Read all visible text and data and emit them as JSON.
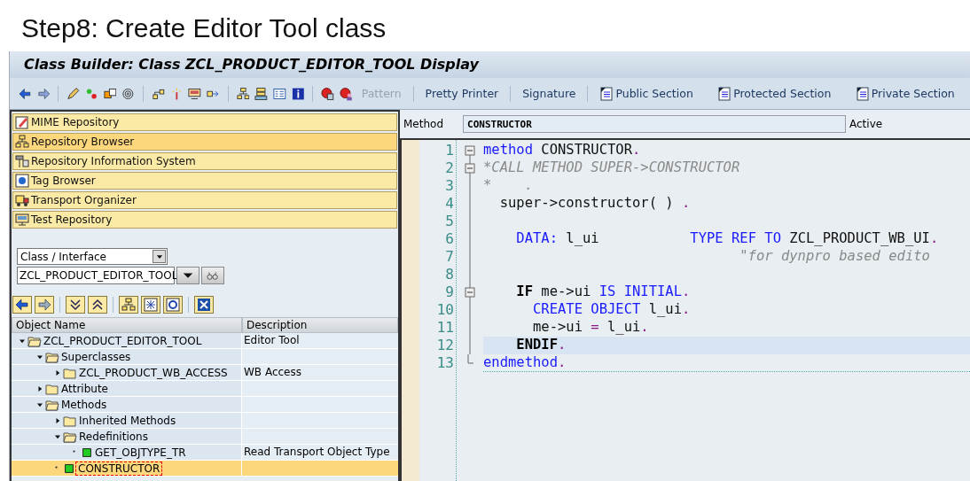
{
  "heading": "Step8: Create Editor Tool class",
  "window": {
    "title": "Class Builder: Class ZCL_PRODUCT_EDITOR_TOOL Display"
  },
  "toolbar": {
    "buttons": [
      {
        "label": "Pattern",
        "kind": "text",
        "disabled": true
      },
      {
        "label": "Pretty Printer",
        "kind": "text",
        "disabled": false
      },
      {
        "label": "Signature",
        "kind": "text",
        "disabled": false
      },
      {
        "label": "Public Section",
        "kind": "section",
        "disabled": false
      },
      {
        "label": "Protected Section",
        "kind": "section",
        "disabled": false
      },
      {
        "label": "Private Section",
        "kind": "section",
        "disabled": false
      }
    ]
  },
  "navigator": {
    "items": [
      {
        "label": "MIME Repository",
        "kind": "mime",
        "selected": false
      },
      {
        "label": "Repository Browser",
        "kind": "browser",
        "selected": true
      },
      {
        "label": "Repository Information System",
        "kind": "info",
        "selected": false
      },
      {
        "label": "Tag Browser",
        "kind": "tag",
        "selected": false
      },
      {
        "label": "Transport Organizer",
        "kind": "transport",
        "selected": false
      },
      {
        "label": "Test Repository",
        "kind": "test",
        "selected": false
      }
    ],
    "object_type": "Class / Interface",
    "object_name": "ZCL_PRODUCT_EDITOR_TOOL"
  },
  "tree": {
    "columns": [
      "Object Name",
      "Description"
    ],
    "nodes": [
      {
        "label": "ZCL_PRODUCT_EDITOR_TOOL",
        "description": "Editor Tool",
        "kind": "folder",
        "expanded": true,
        "selected": false,
        "children": [
          {
            "label": "Superclasses",
            "kind": "folder",
            "expanded": true,
            "selected": false,
            "children": [
              {
                "label": "ZCL_PRODUCT_WB_ACCESS",
                "description": "WB Access",
                "kind": "folder",
                "expanded": false,
                "selected": false
              }
            ]
          },
          {
            "label": "Attribute",
            "kind": "folder",
            "expanded": false,
            "selected": false
          },
          {
            "label": "Methods",
            "kind": "folder",
            "expanded": true,
            "selected": false,
            "children": [
              {
                "label": "Inherited Methods",
                "kind": "folder",
                "expanded": false,
                "selected": false
              },
              {
                "label": "Redefinitions",
                "kind": "folder",
                "expanded": true,
                "selected": false,
                "children": [
                  {
                    "label": "GET_OBJTYPE_TR",
                    "description": "Read Transport Object Type",
                    "kind": "method",
                    "selected": false
                  }
                ]
              },
              {
                "label": "CONSTRUCTOR",
                "kind": "method",
                "selected": true
              }
            ]
          }
        ]
      }
    ]
  },
  "method_bar": {
    "label": "Method",
    "value": "CONSTRUCTOR",
    "status": "Active"
  },
  "code": {
    "lines": [
      {
        "number": "1",
        "fold_start": true,
        "highlighted": false,
        "tokens": [
          {
            "text": "method",
            "kind": "kw"
          },
          {
            "text": " CONSTRUCTOR",
            "kind": "txt"
          },
          {
            "text": ".",
            "kind": "op"
          }
        ]
      },
      {
        "number": "2",
        "fold_start": true,
        "highlighted": false,
        "tokens": [
          {
            "text": "*CALL METHOD SUPER->CONSTRUCTOR",
            "kind": "cmt"
          }
        ]
      },
      {
        "number": "3",
        "fold_start": false,
        "highlighted": false,
        "tokens": [
          {
            "text": "*    .",
            "kind": "cmt"
          }
        ]
      },
      {
        "number": "4",
        "fold_start": false,
        "highlighted": false,
        "tokens": [
          {
            "text": "  super->constructor( ) ",
            "kind": "txt"
          },
          {
            "text": ".",
            "kind": "op"
          }
        ]
      },
      {
        "number": "5",
        "fold_start": false,
        "highlighted": false
      },
      {
        "number": "6",
        "fold_start": false,
        "highlighted": false,
        "tokens": [
          {
            "text": "    DATA:",
            "kind": "kw"
          },
          {
            "text": " l_ui           ",
            "kind": "txt"
          },
          {
            "text": "TYPE REF TO",
            "kind": "kw"
          },
          {
            "text": " ZCL_PRODUCT_WB_UI",
            "kind": "txt"
          },
          {
            "text": ".",
            "kind": "op"
          }
        ]
      },
      {
        "number": "7",
        "fold_start": false,
        "highlighted": false,
        "tokens": [
          {
            "text": "                               \"for dynpro based edito",
            "kind": "cmt"
          }
        ]
      },
      {
        "number": "8",
        "fold_start": false,
        "highlighted": false
      },
      {
        "number": "9",
        "fold_start": true,
        "highlighted": false,
        "tokens": [
          {
            "text": "    IF",
            "kind": "kwb"
          },
          {
            "text": " me->ui ",
            "kind": "txt"
          },
          {
            "text": "IS INITIAL",
            "kind": "kw"
          },
          {
            "text": ".",
            "kind": "op"
          }
        ]
      },
      {
        "number": "10",
        "fold_start": false,
        "highlighted": false,
        "tokens": [
          {
            "text": "      CREATE OBJECT",
            "kind": "kw"
          },
          {
            "text": " l_ui",
            "kind": "txt"
          },
          {
            "text": ".",
            "kind": "op"
          }
        ]
      },
      {
        "number": "11",
        "fold_start": false,
        "highlighted": false,
        "tokens": [
          {
            "text": "      me->ui ",
            "kind": "txt"
          },
          {
            "text": "=",
            "kind": "op"
          },
          {
            "text": " l_ui",
            "kind": "txt"
          },
          {
            "text": ".",
            "kind": "op"
          }
        ]
      },
      {
        "number": "12",
        "fold_start": false,
        "highlighted": true,
        "tokens": [
          {
            "text": "    ENDIF",
            "kind": "kwb"
          },
          {
            "text": ".",
            "kind": "op"
          }
        ]
      },
      {
        "number": "13",
        "fold_start": false,
        "highlighted": false,
        "tokens": [
          {
            "text": "endmethod",
            "kind": "kw"
          },
          {
            "text": ".",
            "kind": "op"
          }
        ]
      }
    ]
  }
}
